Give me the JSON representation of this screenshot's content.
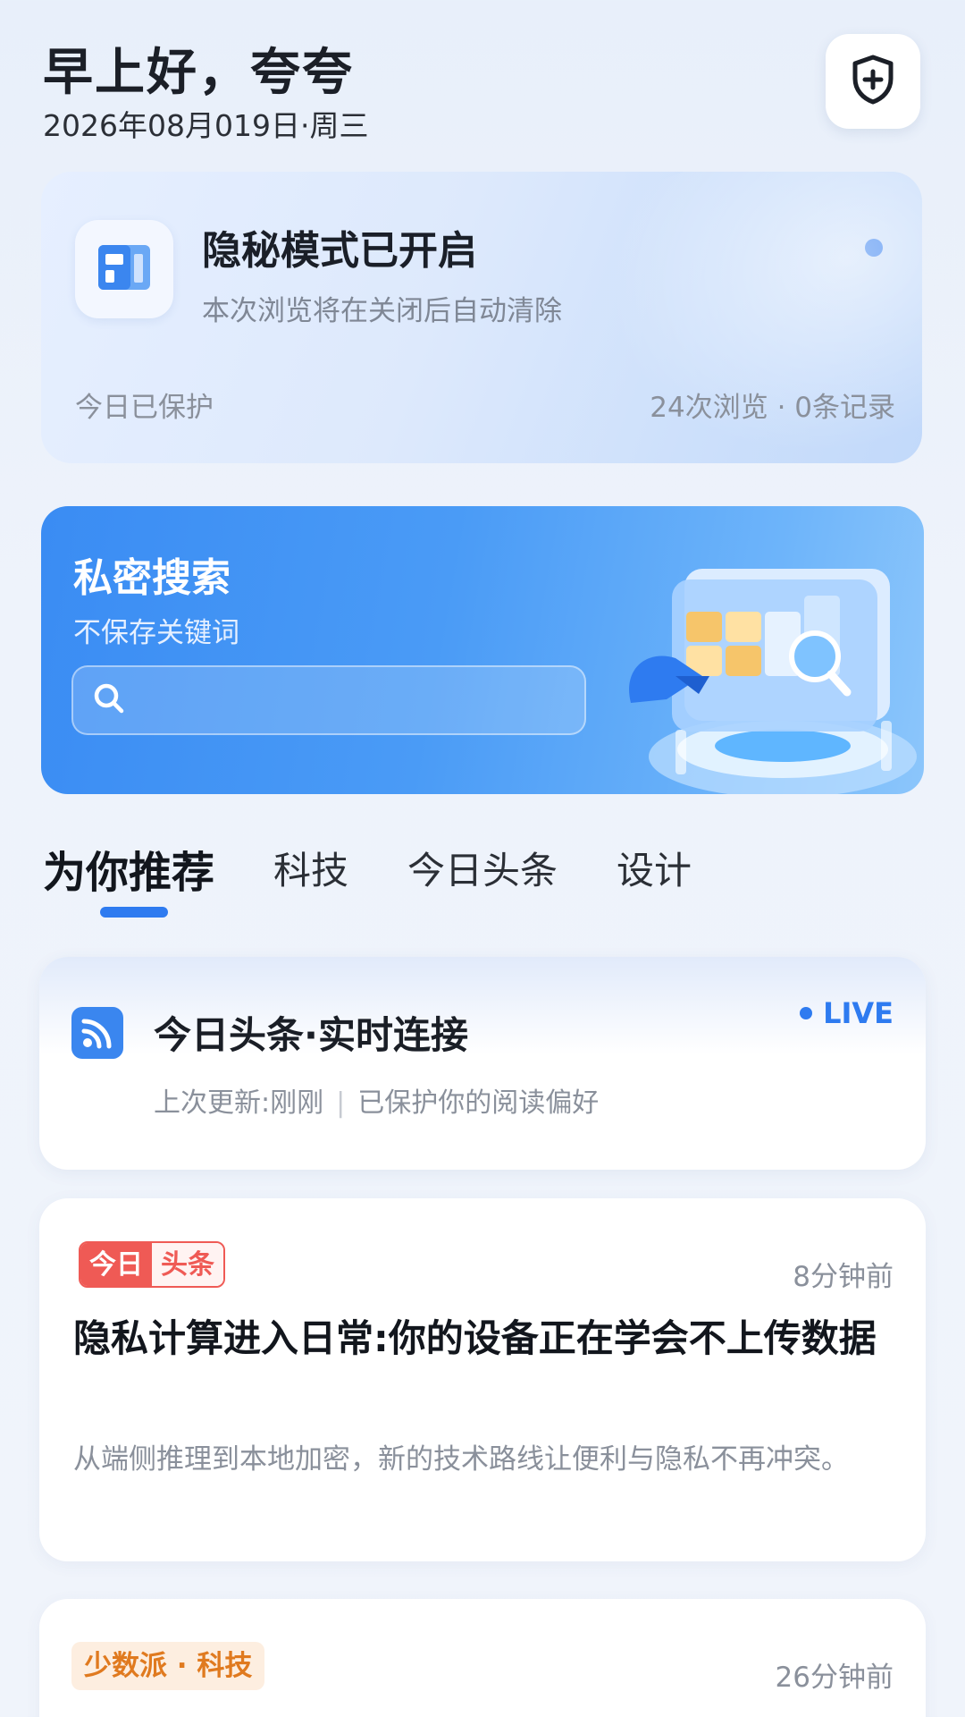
{
  "header": {
    "greeting": "早上好，夸夸",
    "date": "2026年08月019日·周三"
  },
  "incognito": {
    "title": "隐秘模式已开启",
    "subtitle": "本次浏览将在关闭后自动清除",
    "protected_label": "今日已保护",
    "stats": "24次浏览 · 0条记录"
  },
  "private_search": {
    "title": "私密搜索",
    "subtitle": "不保存关键词",
    "placeholder": ""
  },
  "tabs": [
    {
      "label": "为你推荐",
      "active": true
    },
    {
      "label": "科技",
      "active": false
    },
    {
      "label": "今日头条",
      "active": false
    },
    {
      "label": "设计",
      "active": false
    }
  ],
  "live_card": {
    "title": "今日头条·实时连接",
    "badge": "LIVE",
    "updated": "上次更新:刚刚",
    "separator": "|",
    "protected": "已保护你的阅读偏好"
  },
  "articles": [
    {
      "tag_a": "今日",
      "tag_b": "头条",
      "time": "8分钟前",
      "title": "隐私计算进入日常:你的设备正在学会不上传数据",
      "desc": "从端侧推理到本地加密，新的技术路线让便利与隐私不再冲突。"
    },
    {
      "tag": "少数派 · 科技",
      "time": "26分钟前"
    }
  ],
  "colors": {
    "accent": "#2e7bf0",
    "tag_red": "#ef5a55",
    "tag_orange": "#e07a1f"
  },
  "icons": {
    "shield_add": "shield-plus-icon",
    "incognito": "incognito-window-icon",
    "search": "search-icon",
    "rss": "rss-icon"
  }
}
